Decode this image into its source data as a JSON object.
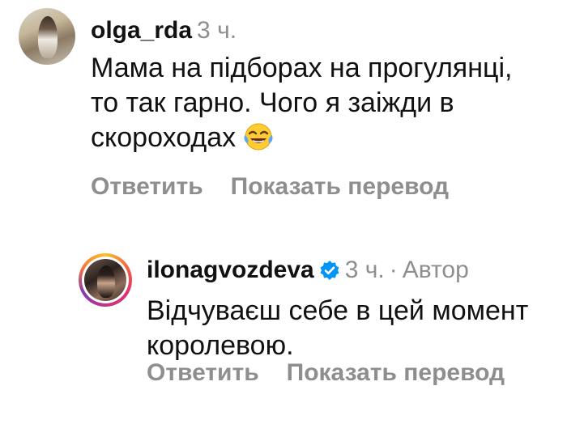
{
  "comments": [
    {
      "username": "olga_rda",
      "time": "3 ч.",
      "text": "Мама на підборах на прогулянці, то так гарно. Чого я заіжди в скороходах",
      "emoji": "face-with-tears-of-joy",
      "actions": {
        "reply": "Ответить",
        "translate": "Показать перевод"
      }
    },
    {
      "username": "ilonagvozdeva",
      "verified": true,
      "time": "3 ч.",
      "separator": "·",
      "author_badge": "Автор",
      "text": "Відчуваєш себе в цей момент королевою.",
      "actions": {
        "reply": "Ответить",
        "translate": "Показать перевод"
      }
    }
  ],
  "colors": {
    "text": "#111111",
    "secondary": "#8e8e8e",
    "verified_blue": "#0095f6",
    "background": "#ffffff"
  }
}
